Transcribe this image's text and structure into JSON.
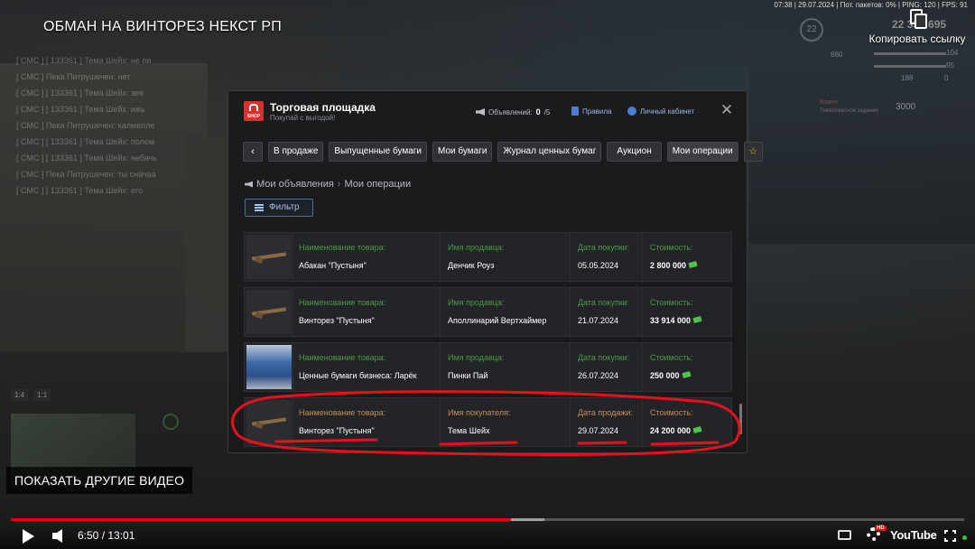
{
  "video": {
    "title": "ОБМАН НА ВИНТОРЕЗ НЕКСТ РП",
    "copy_link_label": "Копировать ссылку",
    "show_more_label": "ПОКАЗАТЬ ДРУГИЕ ВИДЕО",
    "time": "6:50 / 13:01",
    "progress_played": 0.525,
    "progress_loaded": 0.56,
    "youtube_logo": "YouTube",
    "hd_badge": "HD"
  },
  "game": {
    "status_line": "07:38 | 29.07.2024 | Пот. пакетов: 0% | PING: 120 | FPS: 91",
    "hud": {
      "level": "22",
      "money": "22 333 695",
      "stat_1": "660",
      "stat_2": "104",
      "stat_3": "95",
      "stat_4": "188",
      "stat_5": "0",
      "clan": "Клинч",
      "clan_sub": "Тяжеловесное задание",
      "amount": "3000"
    },
    "chat": [
      "[ СМС ] [ 133361 ] Тема Шейх: не пи",
      "[ СМС ] Пека Питрушечен: нет",
      "[ СМС ] [ 133361 ] Тема Шейх: зея",
      "[ СМС ] [ 133361 ] Тема Шейх: ижь",
      "[ СМС ] Пека Питрушечен: калмелле",
      "[ СМС ] [ 133361 ] Тема Шейх: полем",
      "[ СМС ] [ 133361 ] Тема Шейх: небачь",
      "[ СМС ] Пека Питрушечен: ты сначаа",
      "[ СМС ] [ 133361 ] Тема Шейх: его"
    ],
    "map_scales": [
      "1:4",
      "1:1"
    ]
  },
  "market": {
    "title": "Торговая площадка",
    "subtitle": "Покупай с выгодой!",
    "shop_logo_text": "SHOP",
    "ads_label": "Объявлений:",
    "ads_count": "0",
    "ads_limit": "/5",
    "rules_label": "Правила",
    "cabinet_label": "Личный кабинет",
    "tabs": [
      {
        "label": "В продаже"
      },
      {
        "label": "Выпущенные бумаги"
      },
      {
        "label": "Мои бумаги"
      },
      {
        "label": "Журнал ценных бумаг"
      },
      {
        "label": "Аукцион"
      },
      {
        "label": "Мои операции"
      }
    ],
    "breadcrumb": {
      "parent": "Мои объявления",
      "current": "Мои операции"
    },
    "filter_label": "Фильтр",
    "rows": [
      {
        "type": "purchase",
        "thumb": "rifle",
        "item_label": "Наименование товара:",
        "item": "Абакан \"Пустыня\"",
        "person_label": "Имя продавца:",
        "person": "Денчик Роуз",
        "date_label": "Дата покупки:",
        "date": "05.05.2024",
        "price_label": "Стоимость:",
        "price": "2 800 000"
      },
      {
        "type": "purchase",
        "thumb": "rifle",
        "item_label": "Наименование товара:",
        "item": "Винторез \"Пустыня\"",
        "person_label": "Имя продавца:",
        "person": "Аполлинарий Вертхаймер",
        "date_label": "Дата покупки:",
        "date": "21.07.2024",
        "price_label": "Стоимость:",
        "price": "33 914 000"
      },
      {
        "type": "purchase",
        "thumb": "kiosk",
        "item_label": "Наименование товара:",
        "item": "Ценные бумаги бизнеса: Ларёк",
        "person_label": "Имя продавца:",
        "person": "Пинки Пай",
        "date_label": "Дата покупки:",
        "date": "26.07.2024",
        "price_label": "Стоимость:",
        "price": "250 000"
      },
      {
        "type": "sale",
        "thumb": "rifle",
        "item_label": "Наименование товара:",
        "item": "Винторез \"Пустыня\"",
        "person_label": "Имя покупателя:",
        "person": "Тема Шейх",
        "date_label": "Дата продажи:",
        "date": "29.07.2024",
        "price_label": "Стоимость:",
        "price": "24 200 000"
      }
    ]
  },
  "colors": {
    "purchase_label": "#4d9a45",
    "sale_label": "#c98d4e",
    "annotation": "#e8101a",
    "progress": "#e00000",
    "shop_red": "#d8312a"
  }
}
